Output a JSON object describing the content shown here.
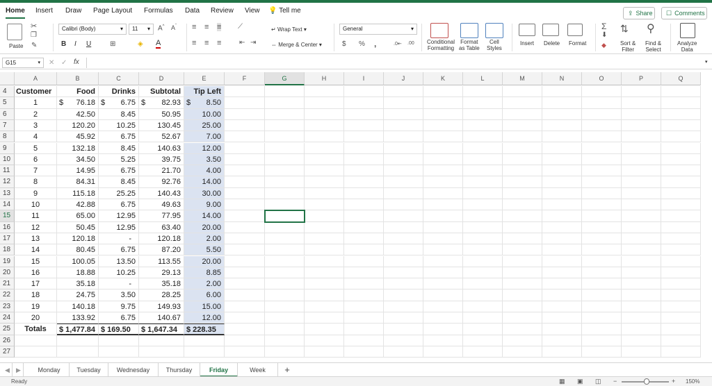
{
  "tabs": [
    "Home",
    "Insert",
    "Draw",
    "Page Layout",
    "Formulas",
    "Data",
    "Review",
    "View"
  ],
  "tell_me": "Tell me",
  "share_label": "Share",
  "comments_label": "Comments",
  "ribbon": {
    "paste": "Paste",
    "font_name": "Calibri (Body)",
    "font_size": "11",
    "bold": "B",
    "italic": "I",
    "underline": "U",
    "wrap_text": "Wrap Text",
    "merge_center": "Merge & Center",
    "number_format": "General",
    "currency": "$",
    "percent": "%",
    "comma": ",",
    "cond_format": [
      "Conditional",
      "Formatting"
    ],
    "format_table": [
      "Format",
      "as Table"
    ],
    "cell_styles": [
      "Cell",
      "Styles"
    ],
    "insert": "Insert",
    "delete": "Delete",
    "format": "Format",
    "sort_filter": [
      "Sort &",
      "Filter"
    ],
    "find_select": [
      "Find &",
      "Select"
    ],
    "analyze": [
      "Analyze",
      "Data"
    ]
  },
  "namebox": "G15",
  "fx": "fx",
  "columns": [
    "A",
    "B",
    "C",
    "D",
    "E",
    "F",
    "G",
    "H",
    "I",
    "J",
    "K",
    "L",
    "M",
    "N",
    "O",
    "P",
    "Q"
  ],
  "header_row": {
    "row": "4",
    "customer": "Customer",
    "food": "Food",
    "drinks": "Drinks",
    "subtotal": "Subtotal",
    "tip": "Tip Left"
  },
  "rows": [
    {
      "row": "5",
      "customer": "1",
      "food": "76.18",
      "drinks": "6.75",
      "subtotal": "82.93",
      "tip": "8.50"
    },
    {
      "row": "6",
      "customer": "2",
      "food": "42.50",
      "drinks": "8.45",
      "subtotal": "50.95",
      "tip": "10.00"
    },
    {
      "row": "7",
      "customer": "3",
      "food": "120.20",
      "drinks": "10.25",
      "subtotal": "130.45",
      "tip": "25.00"
    },
    {
      "row": "8",
      "customer": "4",
      "food": "45.92",
      "drinks": "6.75",
      "subtotal": "52.67",
      "tip": "7.00"
    },
    {
      "row": "9",
      "customer": "5",
      "food": "132.18",
      "drinks": "8.45",
      "subtotal": "140.63",
      "tip": "12.00"
    },
    {
      "row": "10",
      "customer": "6",
      "food": "34.50",
      "drinks": "5.25",
      "subtotal": "39.75",
      "tip": "3.50"
    },
    {
      "row": "11",
      "customer": "7",
      "food": "14.95",
      "drinks": "6.75",
      "subtotal": "21.70",
      "tip": "4.00"
    },
    {
      "row": "12",
      "customer": "8",
      "food": "84.31",
      "drinks": "8.45",
      "subtotal": "92.76",
      "tip": "14.00"
    },
    {
      "row": "13",
      "customer": "9",
      "food": "115.18",
      "drinks": "25.25",
      "subtotal": "140.43",
      "tip": "30.00"
    },
    {
      "row": "14",
      "customer": "10",
      "food": "42.88",
      "drinks": "6.75",
      "subtotal": "49.63",
      "tip": "9.00"
    },
    {
      "row": "15",
      "customer": "11",
      "food": "65.00",
      "drinks": "12.95",
      "subtotal": "77.95",
      "tip": "14.00"
    },
    {
      "row": "16",
      "customer": "12",
      "food": "50.45",
      "drinks": "12.95",
      "subtotal": "63.40",
      "tip": "20.00"
    },
    {
      "row": "17",
      "customer": "13",
      "food": "120.18",
      "drinks": "-",
      "subtotal": "120.18",
      "tip": "2.00"
    },
    {
      "row": "18",
      "customer": "14",
      "food": "80.45",
      "drinks": "6.75",
      "subtotal": "87.20",
      "tip": "5.50"
    },
    {
      "row": "19",
      "customer": "15",
      "food": "100.05",
      "drinks": "13.50",
      "subtotal": "113.55",
      "tip": "20.00"
    },
    {
      "row": "20",
      "customer": "16",
      "food": "18.88",
      "drinks": "10.25",
      "subtotal": "29.13",
      "tip": "8.85"
    },
    {
      "row": "21",
      "customer": "17",
      "food": "35.18",
      "drinks": "-",
      "subtotal": "35.18",
      "tip": "2.00"
    },
    {
      "row": "22",
      "customer": "18",
      "food": "24.75",
      "drinks": "3.50",
      "subtotal": "28.25",
      "tip": "6.00"
    },
    {
      "row": "23",
      "customer": "19",
      "food": "140.18",
      "drinks": "9.75",
      "subtotal": "149.93",
      "tip": "15.00"
    },
    {
      "row": "24",
      "customer": "20",
      "food": "133.92",
      "drinks": "6.75",
      "subtotal": "140.67",
      "tip": "12.00"
    }
  ],
  "totals": {
    "row": "25",
    "label": "Totals",
    "food": "$ 1,477.84",
    "drinks": "$ 169.50",
    "subtotal": "$ 1,647.34",
    "tip": "$ 228.35"
  },
  "extra_rows": [
    "26",
    "27"
  ],
  "currency_symbol": "$",
  "sheet_tabs": [
    "Monday",
    "Tuesday",
    "Wednesday",
    "Thursday",
    "Friday",
    "Week"
  ],
  "active_sheet": "Friday",
  "status": "Ready",
  "zoom": "150%",
  "accent_color": "#217346",
  "selected_cell": "G15"
}
